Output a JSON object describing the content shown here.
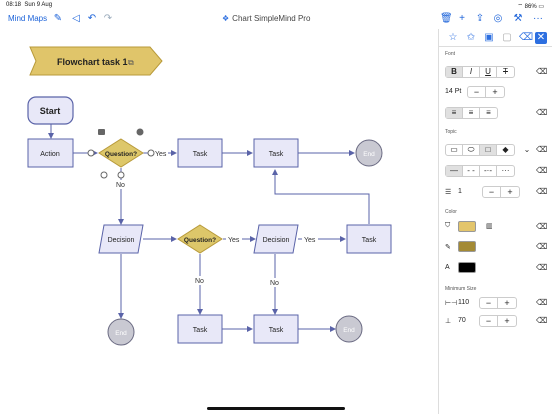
{
  "status_bar": {
    "time": "08:18",
    "date": "Sun 9 Aug",
    "battery": "86%"
  },
  "toolbar": {
    "mind_maps_label": "Mind Maps",
    "title": "Chart SimpleMind Pro"
  },
  "canvas": {
    "title_banner": "Flowchart task 1",
    "nodes": {
      "start": "Start",
      "action": "Action",
      "question1": "Question?",
      "task1": "Task",
      "task2": "Task",
      "end1": "End",
      "decision1": "Decision",
      "question2": "Question?",
      "decision2": "Decision",
      "task3": "Task",
      "end2": "End",
      "task4": "Task",
      "task5": "Task",
      "end3": "End"
    },
    "edge_labels": {
      "yes1": "Yes",
      "no1": "No",
      "yes2": "Yes",
      "yes3": "Yes",
      "no2": "No",
      "no3": "No"
    },
    "colors": {
      "node_fill": "#e8e8f8",
      "node_stroke": "#5a63a8",
      "diamond_fill": "#ddc76a",
      "end_fill": "#c9c9d2",
      "banner_fill": "#e0c56a"
    }
  },
  "panel": {
    "font_section": "Font",
    "font_size": "14 Pt",
    "topic_section": "Topic",
    "line_width": "1",
    "color_section": "Color",
    "colors": {
      "fill": "#e3c56b",
      "border": "#a38a35",
      "text": "#000000"
    },
    "min_size_section": "Minimum Size",
    "min_width": "110",
    "min_height": "70"
  }
}
